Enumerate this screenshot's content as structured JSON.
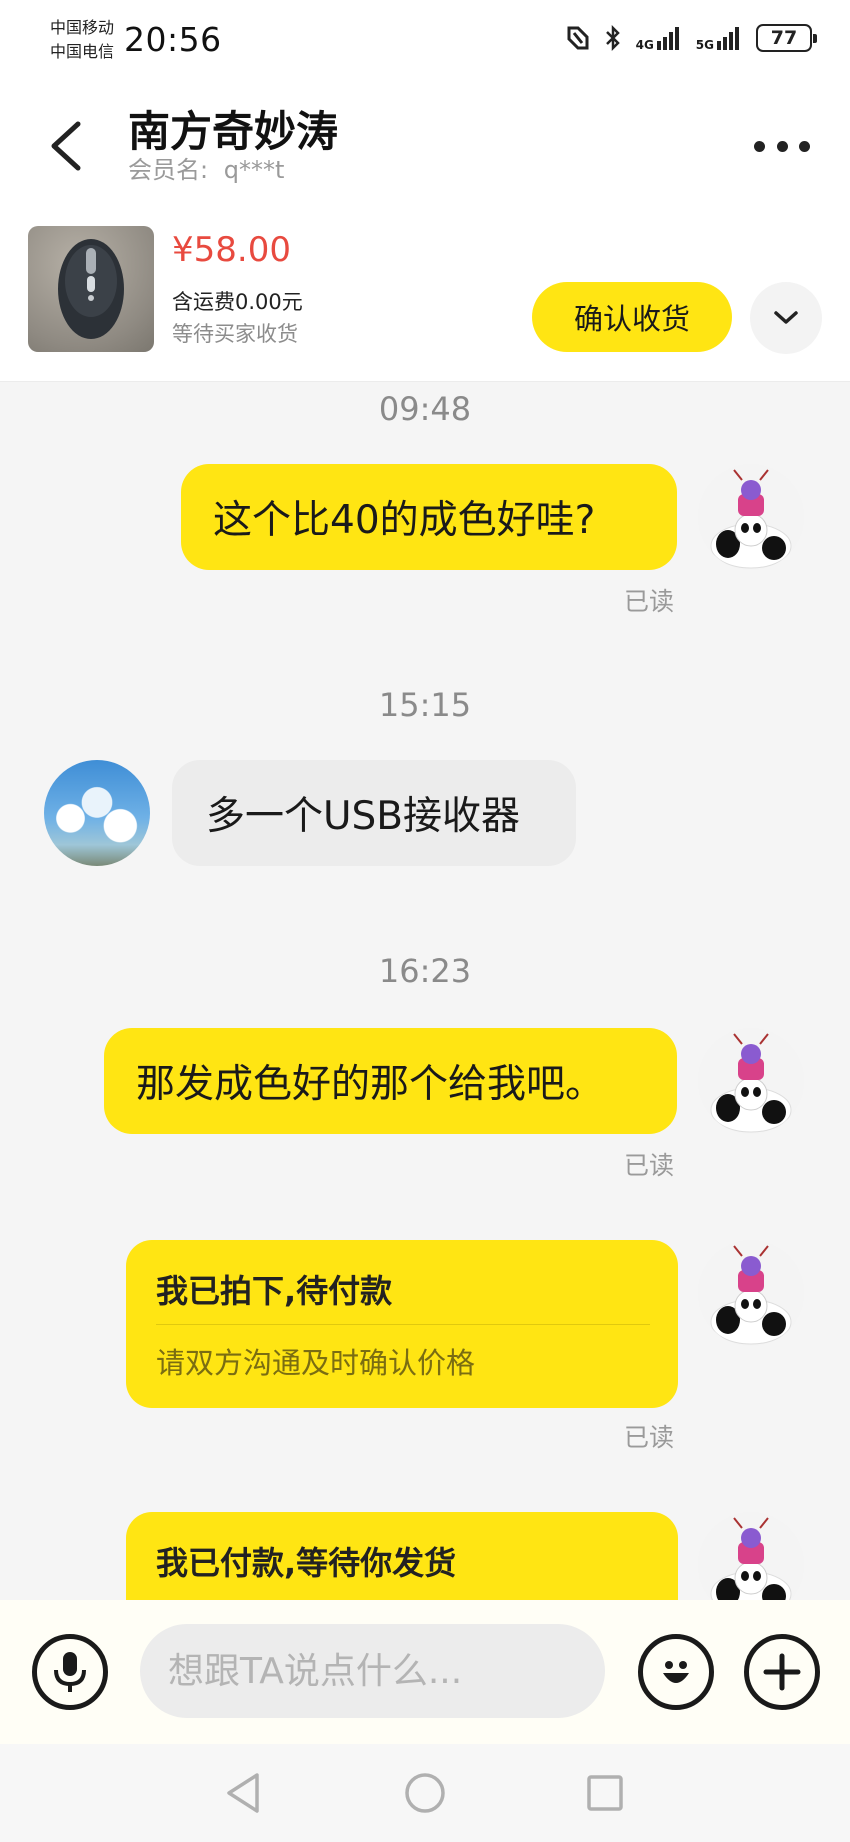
{
  "status_bar": {
    "carrier_1": "中国移动",
    "carrier_2": "中国电信",
    "time": "20:56",
    "net_1": "4G",
    "net_2": "5G",
    "battery": "77"
  },
  "header": {
    "contact_name": "南方奇妙涛",
    "member_label": "会员名:",
    "member_id": "q***t"
  },
  "product": {
    "price": "¥58.00",
    "shipping": "含运费0.00元",
    "status": "等待买家收货",
    "confirm_label": "确认收货"
  },
  "chat": {
    "messages": [
      {
        "time": "09:48",
        "side": "right",
        "text": "这个比40的成色好哇?",
        "read": "已读"
      },
      {
        "time": "15:15",
        "side": "left",
        "text": "多一个USB接收器"
      },
      {
        "time": "16:23",
        "side": "right",
        "text": "那发成色好的那个给我吧。",
        "read": "已读"
      }
    ],
    "cards": [
      {
        "title": "我已拍下,待付款",
        "subtitle": "请双方沟通及时确认价格",
        "read": "已读"
      },
      {
        "title": "我已付款,等待你发货"
      }
    ]
  },
  "input": {
    "placeholder": "想跟TA说点什么..."
  },
  "colors": {
    "accent_yellow": "#ffe513",
    "price_red": "#e84a3f",
    "muted_gray": "#9a9a9a"
  },
  "icons": [
    "back-arrow-icon",
    "more-dots-icon",
    "chevron-down-icon",
    "microphone-icon",
    "emoji-icon",
    "plus-icon",
    "nav-back-icon",
    "nav-home-icon",
    "nav-recents-icon",
    "nfc-icon",
    "bluetooth-icon",
    "signal-icon"
  ]
}
